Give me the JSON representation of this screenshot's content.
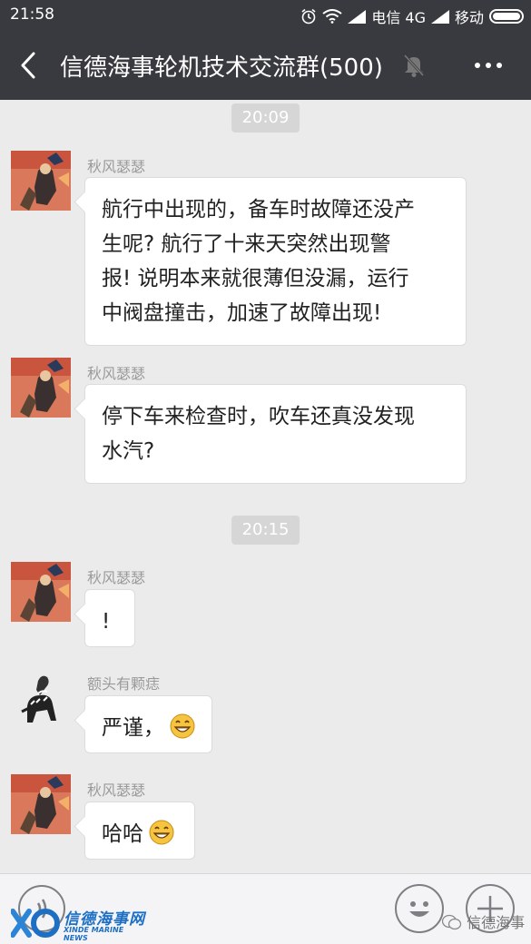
{
  "status_bar": {
    "time": "21:58",
    "carrier1": "电信 4G",
    "carrier2": "移动"
  },
  "header": {
    "title": "信德海事轮机技术交流群(500)",
    "icons": [
      "back-arrow-icon",
      "mute-bell-icon",
      "more-dots-icon"
    ]
  },
  "chat": {
    "timestamps": [
      "20:09",
      "20:15"
    ],
    "messages": [
      {
        "sender": "秋风瑟瑟",
        "lines": [
          "航行中出现的，备车时故障还没产",
          "生呢? 航行了十来天突然出现警",
          "报! 说明本来就很薄但没漏，运行",
          "中阀盘撞击，加速了故障出现!"
        ]
      },
      {
        "sender": "秋风瑟瑟",
        "lines": [
          "停下车来检查时，吹车还真没发现",
          "水汽?"
        ]
      },
      {
        "sender": "秋风瑟瑟",
        "lines": [
          "!"
        ]
      },
      {
        "sender": "额头有颗痣",
        "lines": [
          "严谨，"
        ],
        "emoji": "grin-emoji"
      },
      {
        "sender": "秋风瑟瑟",
        "lines": [
          "哈哈"
        ],
        "emoji": "grin-emoji"
      }
    ]
  },
  "watermark": {
    "logo_cn": "信德海事网",
    "logo_en": "XINDE MARINE NEWS",
    "wechat_label": "信德海事"
  },
  "colors": {
    "header_bg": "#393a3f",
    "chat_bg": "#ebebeb",
    "bubble_bg": "#ffffff"
  }
}
